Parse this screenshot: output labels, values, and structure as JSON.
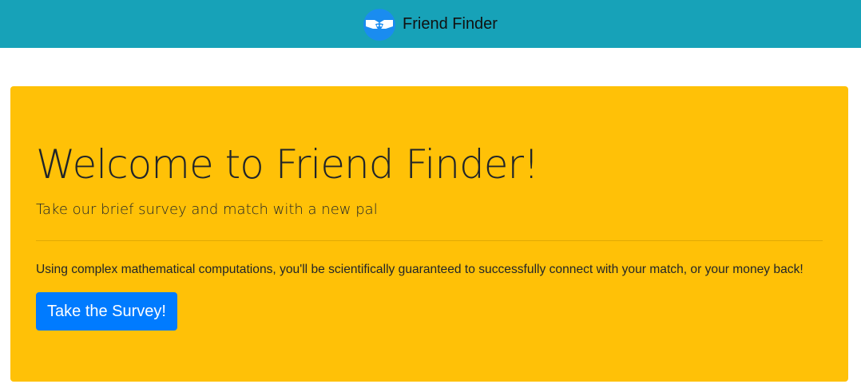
{
  "navbar": {
    "brand_label": "Friend Finder",
    "logo_icon": "handshake-icon",
    "background_color": "#17a2b8"
  },
  "jumbotron": {
    "title": "Welcome to Friend Finder!",
    "lead": "Take our brief survey and match with a new pal",
    "body": "Using complex mathematical computations, you'll be scientifically guaranteed to successfully connect with your match, or your money back!",
    "button_label": "Take the Survey!",
    "background_color": "#ffc107",
    "button_color": "#007bff"
  }
}
